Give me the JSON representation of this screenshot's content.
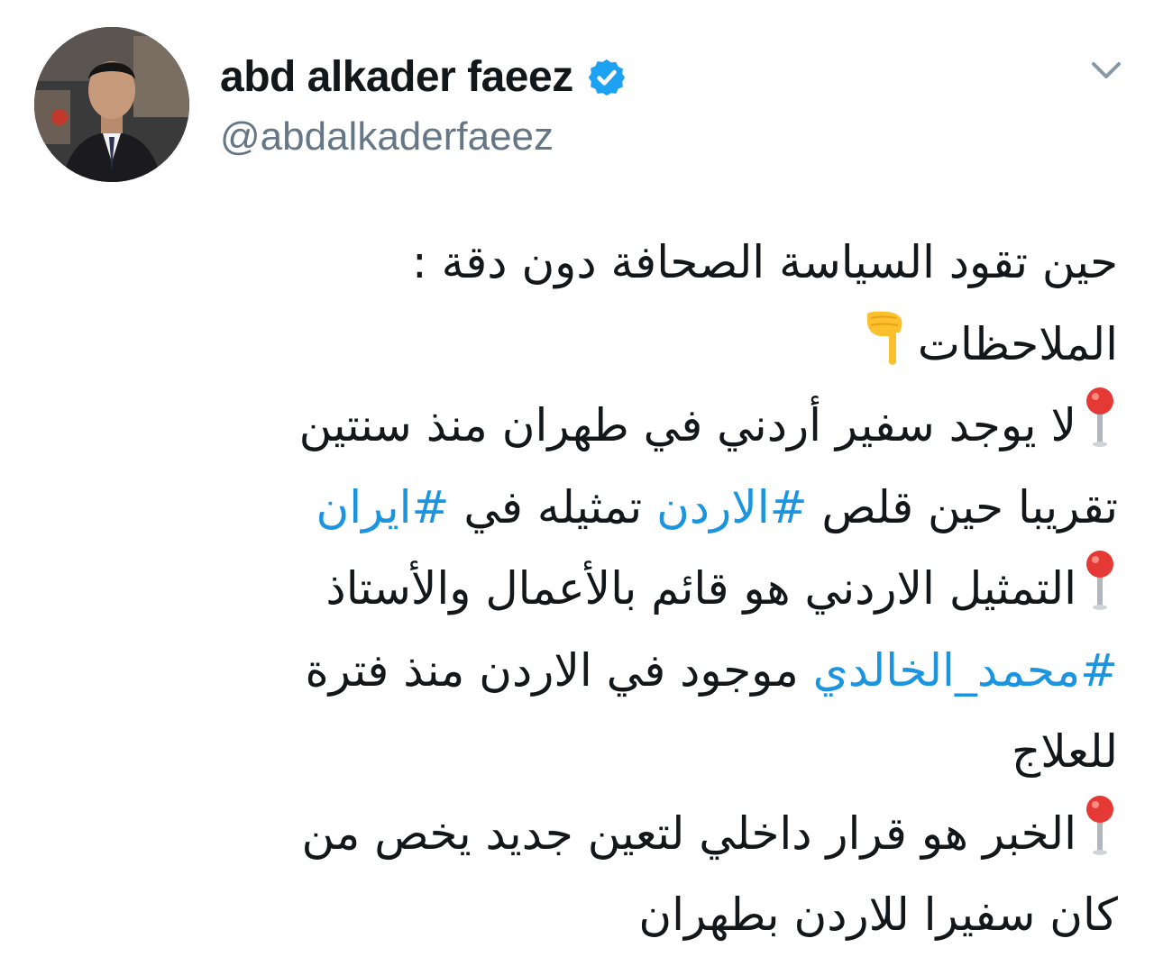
{
  "tweet": {
    "author": {
      "display_name": "abd alkader faeez",
      "handle": "@abdalkaderfaeez",
      "verified": true
    },
    "icons": {
      "verified": "verified-badge-icon",
      "menu": "chevron-down-icon",
      "pin": "round-pushpin-emoji",
      "pointing": "backhand-index-pointing-down-emoji"
    },
    "colors": {
      "hashtag": "#1b95e0",
      "verified_badge": "#1da1f2",
      "handle_text": "#657786"
    },
    "lines": {
      "l1": "حين تقود السياسة الصحافة دون دقة :",
      "l2": "الملاحظات",
      "l3": "لا يوجد سفير أردني في طهران منذ سنتين",
      "l4_a": "تقريبا حين قلص ",
      "l4_tag1": "#الاردن",
      "l4_b": " تمثيله في ",
      "l4_tag2": "#ايران",
      "l5": "التمثيل الاردني هو قائم بالأعمال والأستاذ",
      "l6_tag": "#محمد_الخالدي",
      "l6_b": " موجود في الاردن منذ فترة",
      "l7": "للعلاج",
      "l8": "الخبر هو قرار داخلي لتعين جديد يخص من",
      "l9": "كان سفيرا للاردن بطهران"
    }
  }
}
